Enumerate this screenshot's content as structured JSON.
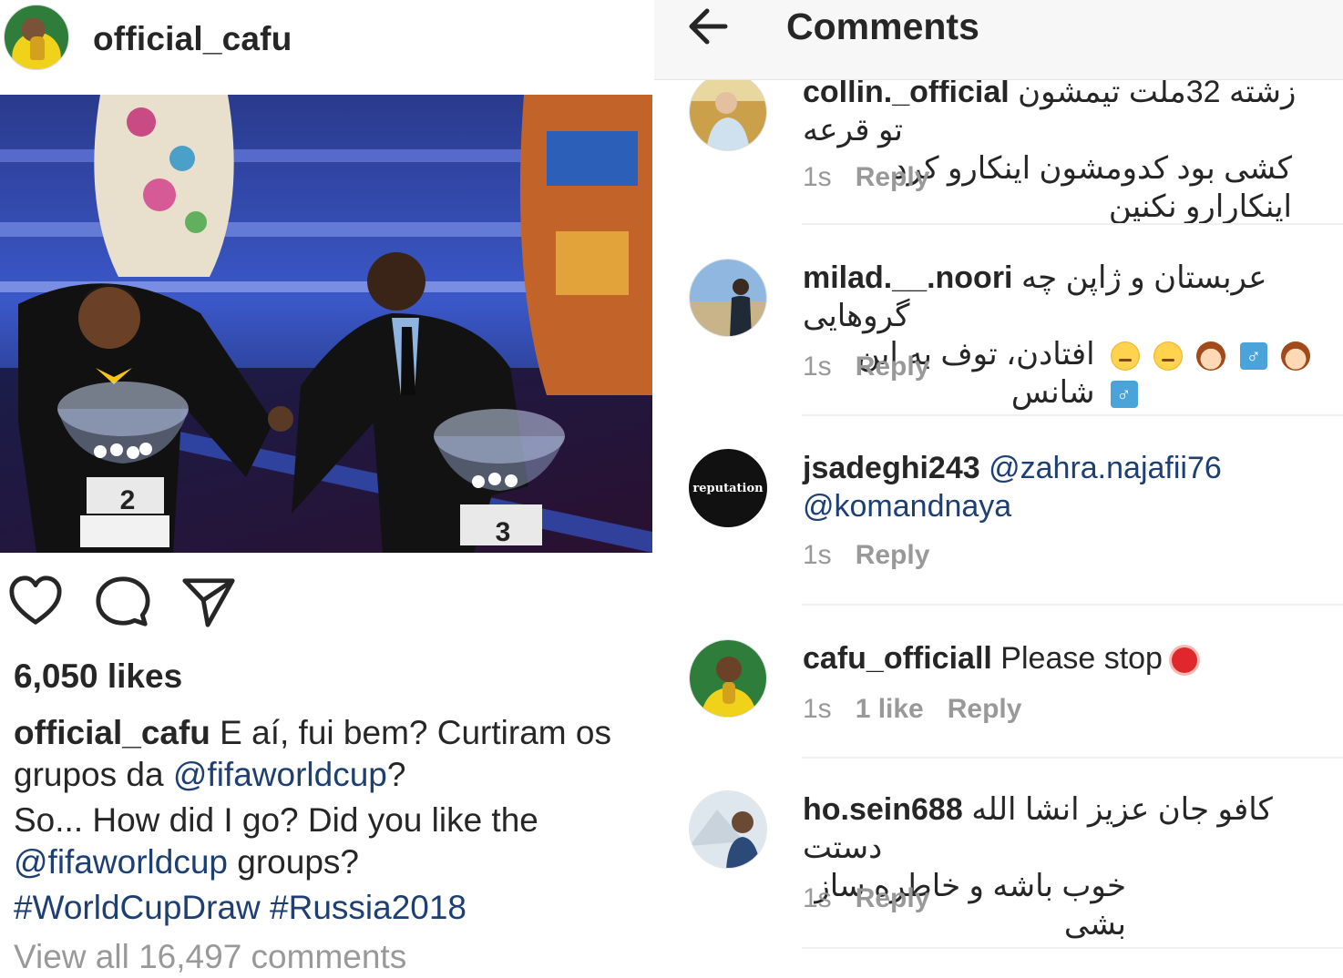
{
  "post": {
    "username": "official_cafu",
    "likes": "6,050 likes",
    "caption": {
      "username": "official_cafu",
      "line1": " E aí, fui bem? Curtiram os",
      "line2_pre": "grupos da ",
      "mention1": "@fifaworldcup",
      "line2_post": "?",
      "line3": "So... How did I go? Did you like the",
      "mention2": "@fifaworldcup",
      "line4_post": " groups?",
      "hashtags": "#WorldCupDraw #Russia2018"
    },
    "view_all": "View all 16,497 comments",
    "actions": {
      "like_icon": "heart-icon",
      "comment_icon": "comment-icon",
      "share_icon": "paper-plane-icon"
    }
  },
  "comments_panel": {
    "title": "Comments",
    "back_icon": "back-arrow-icon",
    "items": [
      {
        "username": "collin._official",
        "text_line1": "زشته 32ملت تیمشون تو قرعه",
        "text_line2": "کشی بود کدومشون اینکارو کرد اینکارارو نکنین",
        "time": "1s",
        "reply": "Reply"
      },
      {
        "username": "milad.__.noori",
        "text_line1": "عربستان و ژاپن چه گروهایی",
        "text_line2": "افتادن، توف به این شانس",
        "time": "1s",
        "reply": "Reply"
      },
      {
        "username": "jsadeghi243",
        "mention1": "@zahra.najafii76",
        "mention2": "@komandnaya",
        "avatar_text": "reputation",
        "time": "1s",
        "reply": "Reply"
      },
      {
        "username": "cafu_officiall",
        "text": "Please stop",
        "time": "1s",
        "likes": "1 like",
        "reply": "Reply"
      },
      {
        "username": "ho.sein688",
        "text_line1": "کافو جان عزیز انشا الله دستت",
        "text_line2": "خوب باشه و خاطره ساز بشی",
        "time": "1s",
        "reply": "Reply"
      }
    ]
  },
  "colors": {
    "link": "#1d3f73",
    "muted": "#999999",
    "text": "#262626"
  },
  "photo": {
    "box_left_number": "2",
    "box_right_number": "3"
  }
}
